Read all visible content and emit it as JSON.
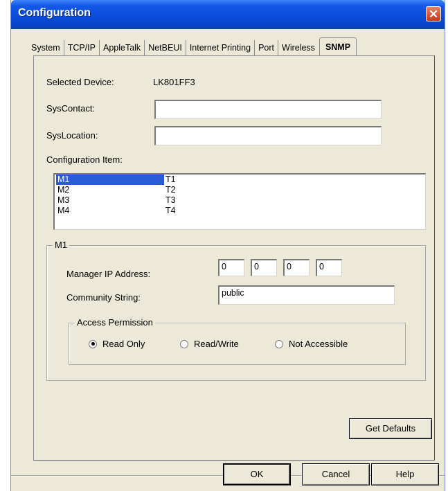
{
  "window": {
    "title": "Configuration"
  },
  "tabs": [
    {
      "label": "System"
    },
    {
      "label": "TCP/IP"
    },
    {
      "label": "AppleTalk"
    },
    {
      "label": "NetBEUI"
    },
    {
      "label": "Internet Printing"
    },
    {
      "label": "Port"
    },
    {
      "label": "Wireless"
    },
    {
      "label": "SNMP",
      "active": true
    }
  ],
  "device": {
    "label": "Selected Device:",
    "value": "LK801FF3"
  },
  "sys_contact": {
    "label": "SysContact:",
    "value": ""
  },
  "sys_location": {
    "label": "SysLocation:",
    "value": ""
  },
  "config_item": {
    "label": "Configuration Item:",
    "rows": [
      {
        "m": "M1",
        "t": "T1",
        "selected": true
      },
      {
        "m": "M2",
        "t": "T2"
      },
      {
        "m": "M3",
        "t": "T3"
      },
      {
        "m": "M4",
        "t": "T4"
      }
    ]
  },
  "manager_group": {
    "title": "M1",
    "ip_label": "Manager IP Address:",
    "ip_octets": [
      "0",
      "0",
      "0",
      "0"
    ],
    "community_label": "Community String:",
    "community_value": "public",
    "access": {
      "title": "Access Permission",
      "options": [
        {
          "label": "Read Only",
          "checked": true
        },
        {
          "label": "Read/Write",
          "checked": false
        },
        {
          "label": "Not Accessible",
          "checked": false
        }
      ]
    }
  },
  "buttons": {
    "get_defaults": "Get Defaults",
    "ok": "OK",
    "cancel": "Cancel",
    "help": "Help"
  }
}
